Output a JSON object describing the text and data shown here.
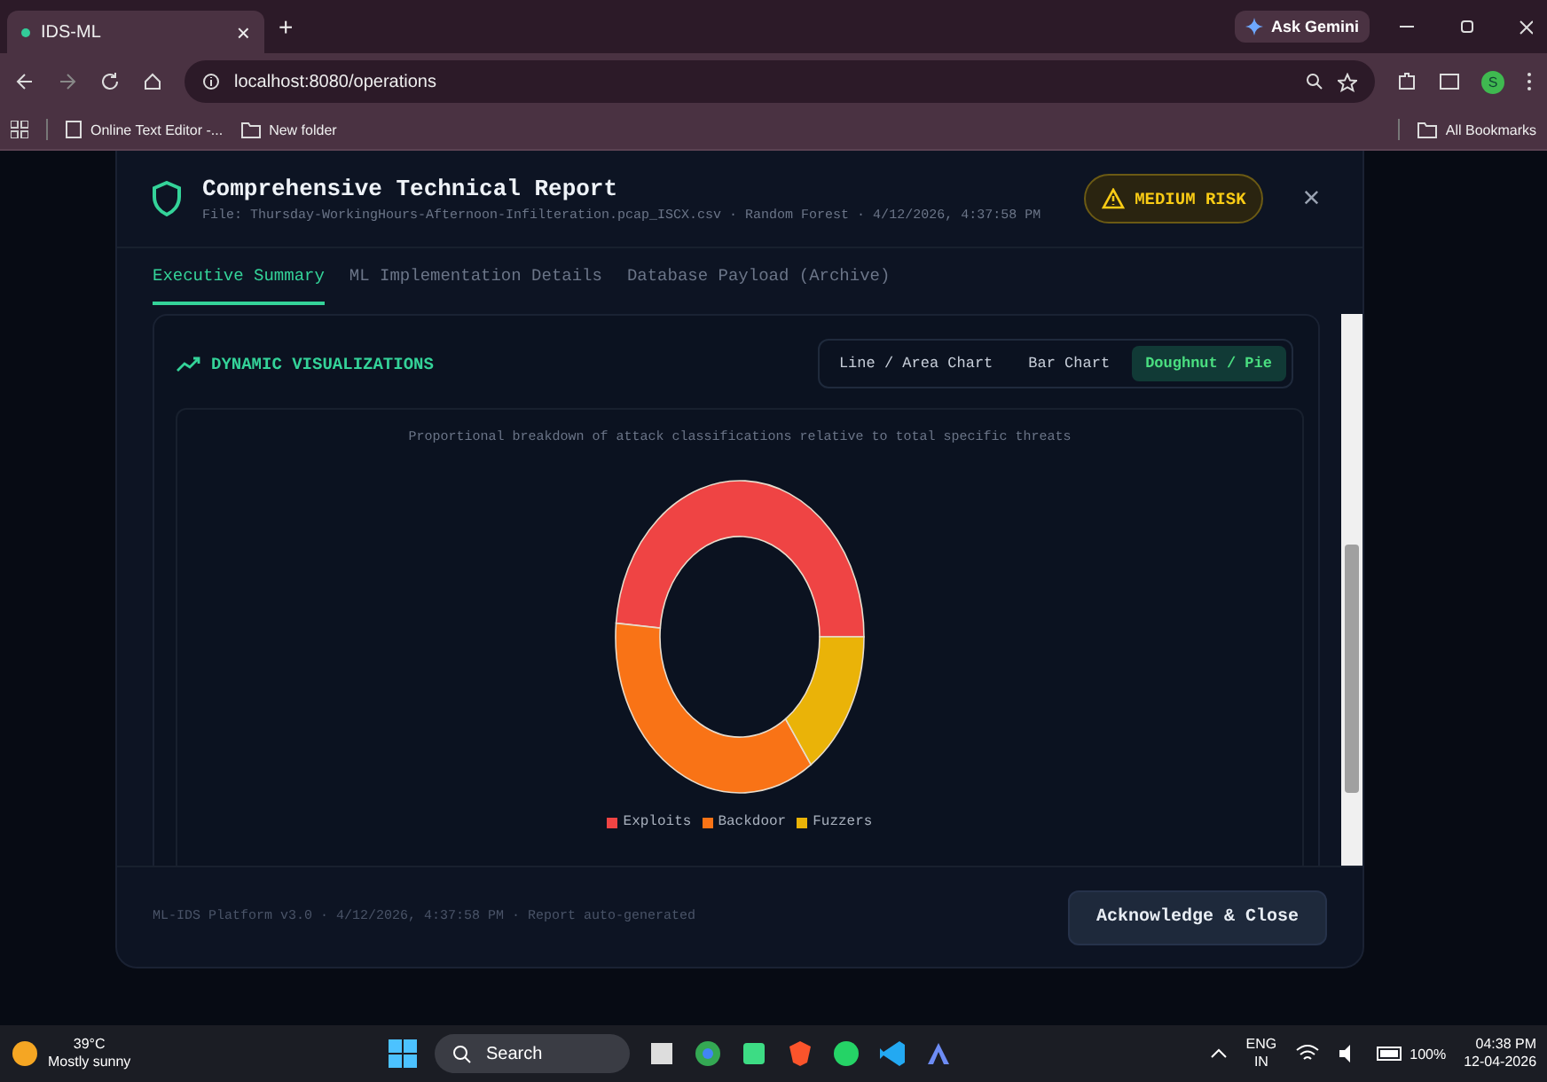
{
  "browser": {
    "tabs": [
      {
        "label": "IDS-ML",
        "selected": true,
        "close": "×"
      }
    ],
    "new_tab": "+",
    "ask_button": "Ask Gemini",
    "address": "localhost:8080/operations",
    "profile": "S",
    "bookmarks": [
      {
        "label": "Online Text Editor -...",
        "kind": "page"
      },
      {
        "label": "New folder",
        "kind": "folder"
      }
    ],
    "all_bookmarks": "All Bookmarks"
  },
  "modal": {
    "title": "Comprehensive Technical Report",
    "subtitle": "File: Thursday-WorkingHours-Afternoon-Infilteration.pcap_ISCX.csv · Random Forest · 4/12/2026, 4:37:58 PM",
    "risk_badge": "MEDIUM RISK",
    "close": "×",
    "tabs": [
      {
        "label": "Executive Summary",
        "selected": true
      },
      {
        "label": "ML Implementation Details",
        "selected": false
      },
      {
        "label": "Database Payload (Archive)",
        "selected": false
      }
    ],
    "section_title": "DYNAMIC VISUALIZATIONS",
    "chart_types": [
      {
        "label": "Line / Area Chart",
        "selected": false
      },
      {
        "label": "Bar Chart",
        "selected": false
      },
      {
        "label": "Doughnut / Pie",
        "selected": true
      }
    ],
    "chart_caption": "Proportional breakdown of attack classifications relative to total specific threats",
    "legend": [
      {
        "label": "Exploits",
        "color": "#ef4444"
      },
      {
        "label": "Backdoor",
        "color": "#f97316"
      },
      {
        "label": "Fuzzers",
        "color": "#eab308"
      }
    ],
    "footer_text": "ML-IDS Platform v3.0 · 4/12/2026, 4:37:58 PM · Report auto-generated",
    "acknowledge_button": "Acknowledge & Close"
  },
  "taskbar": {
    "temperature": "39°C",
    "weather": "Mostly sunny",
    "search": "Search",
    "language": "ENG",
    "region": "IN",
    "battery": "100%",
    "time": "04:38 PM",
    "date": "12-04-2026"
  }
}
